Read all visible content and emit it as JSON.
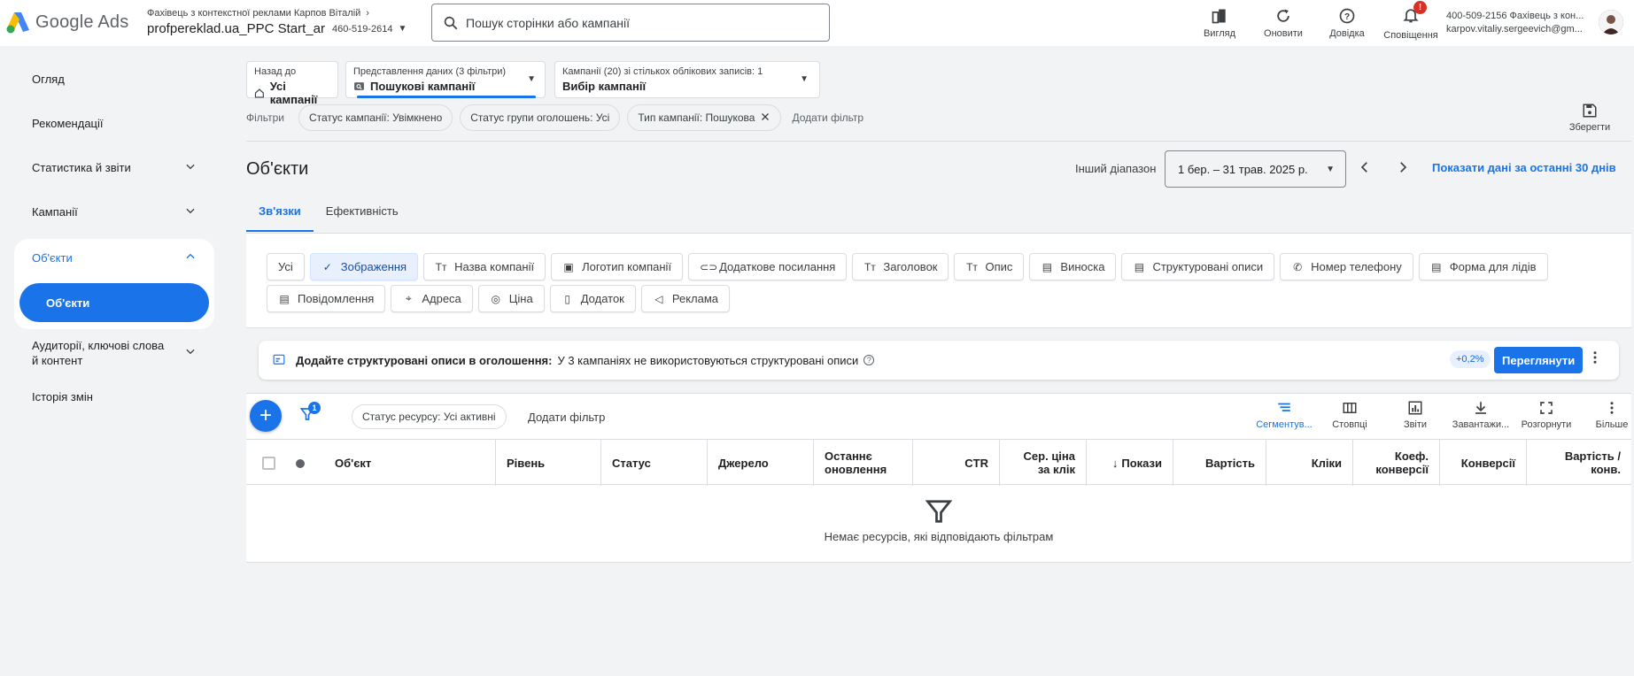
{
  "header": {
    "product": "Google Ads",
    "account_owner": "Фахівець з контекстної реклами Карпов Віталій",
    "account_name": "profpereklad.ua_PPC Start_ar",
    "account_id": "460-519-2614",
    "search_placeholder": "Пошук сторінки або кампанії",
    "actions": [
      {
        "label": "Вигляд",
        "icon": "view-icon"
      },
      {
        "label": "Оновити",
        "icon": "refresh-icon"
      },
      {
        "label": "Довідка",
        "icon": "help-icon"
      },
      {
        "label": "Сповіщення",
        "icon": "bell-icon",
        "badge": "!"
      }
    ],
    "user_line1": "400-509-2156 Фахівець з кон...",
    "user_line2": "karpov.vitaliy.sergeevich@gm..."
  },
  "sidebar": {
    "items": [
      {
        "label": "Огляд"
      },
      {
        "label": "Рекомендації"
      },
      {
        "label": "Статистика й звіти"
      },
      {
        "label": "Кампанії"
      },
      {
        "label": "Об'єкти"
      },
      {
        "label": "Об'єкти"
      },
      {
        "label": "Аудиторії, ключові слова й контент"
      },
      {
        "label": "Історія змін"
      }
    ]
  },
  "selectors": {
    "back_small": "Назад до",
    "back_main": "Усі кампанії",
    "view_small": "Представлення даних (3 фільтри)",
    "view_main": "Пошукові кампанії",
    "campaign_small": "Кампанії (20) зі стількох облікових записів: 1",
    "campaign_main": "Вибір кампанії"
  },
  "filters": {
    "label": "Фільтри",
    "chips": [
      "Статус кампанії: Увімкнено",
      "Статус групи оголошень: Усі",
      "Тип кампанії: Пошукова"
    ],
    "add": "Додати фільтр",
    "save": "Зберегти"
  },
  "page": {
    "title": "Об'єкти",
    "range_label": "Інший діапазон",
    "range_value": "1 бер. – 31 трав. 2025 р.",
    "range_link": "Показати дані за останні 30 днів"
  },
  "tabs": [
    "Зв'язки",
    "Ефективність"
  ],
  "type_chips_row1": [
    {
      "label": "Усі",
      "icon": ""
    },
    {
      "label": "Зображення",
      "icon": "✓"
    },
    {
      "label": "Назва компанії",
      "icon": "Tт"
    },
    {
      "label": "Логотип компанії",
      "icon": "▣"
    },
    {
      "label": "Додаткове посилання",
      "icon": "⊂⊃"
    },
    {
      "label": "Заголовок",
      "icon": "Tт"
    },
    {
      "label": "Опис",
      "icon": "Tт"
    },
    {
      "label": "Виноска",
      "icon": "▤"
    },
    {
      "label": "Структуровані описи",
      "icon": "▤"
    },
    {
      "label": "Номер телефону",
      "icon": "✆"
    },
    {
      "label": "Форма для лідів",
      "icon": "▤"
    }
  ],
  "type_chips_row2": [
    {
      "label": "Повідомлення",
      "icon": "▤"
    },
    {
      "label": "Адреса",
      "icon": "⌖"
    },
    {
      "label": "Ціна",
      "icon": "◎"
    },
    {
      "label": "Додаток",
      "icon": "▯"
    },
    {
      "label": "Реклама",
      "icon": "◁"
    }
  ],
  "banner": {
    "title": "Додайте структуровані описи в оголошення:",
    "text": "У 3 кампаніях не використовуються структуровані описи",
    "help": "?",
    "lift": "+0,2%",
    "button": "Переглянути"
  },
  "table": {
    "fab": "+",
    "filter_count": "1",
    "resource_chip": "Статус ресурсу: Усі активні",
    "add_filter": "Додати фільтр",
    "tools": [
      {
        "label": "Сегментув...",
        "icon": "segment-icon"
      },
      {
        "label": "Стовпці",
        "icon": "columns-icon"
      },
      {
        "label": "Звіти",
        "icon": "reports-icon"
      },
      {
        "label": "Завантажи...",
        "icon": "download-icon"
      },
      {
        "label": "Розгорнути",
        "icon": "expand-icon"
      },
      {
        "label": "Більше",
        "icon": "more-icon"
      }
    ],
    "columns": [
      {
        "label": "Об'єкт"
      },
      {
        "label": "Рівень"
      },
      {
        "label": "Статус"
      },
      {
        "label": "Джерело"
      },
      {
        "label": "Останнє оновлення"
      },
      {
        "label": "CTR"
      },
      {
        "label": "Сер. ціна за клік"
      },
      {
        "label": "Покази",
        "sort": "↓"
      },
      {
        "label": "Вартість"
      },
      {
        "label": "Кліки"
      },
      {
        "label": "Коеф. конверсії"
      },
      {
        "label": "Конверсії"
      },
      {
        "label": "Вартість / конв."
      }
    ],
    "empty_text": "Немає ресурсів, які відповідають фільтрам"
  },
  "colors": {
    "accent": "#1a73e8",
    "badge": "#d93025"
  }
}
